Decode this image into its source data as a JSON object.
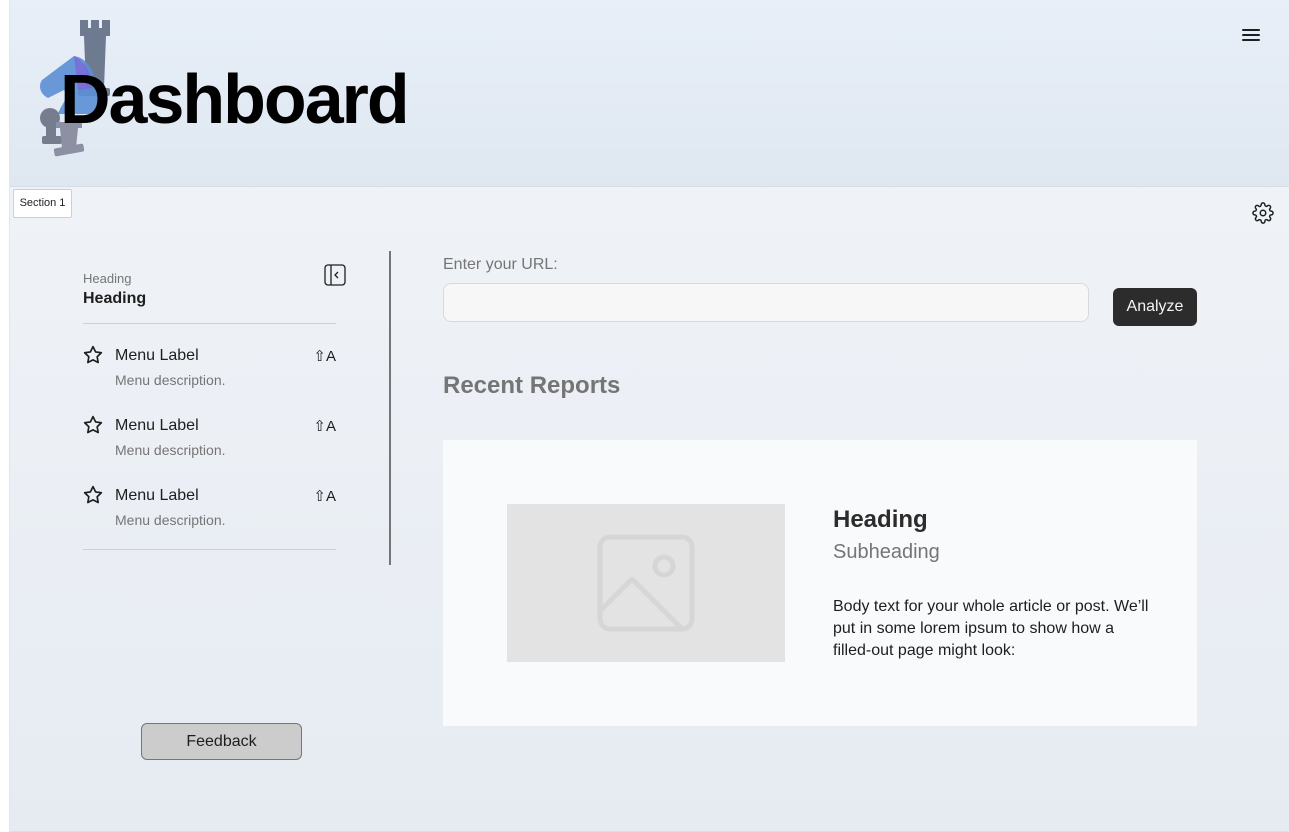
{
  "header": {
    "title": "Dashboard"
  },
  "section": {
    "label": "Section 1"
  },
  "sidebar": {
    "overline": "Heading",
    "title": "Heading",
    "items": [
      {
        "label": "Menu Label",
        "description": "Menu description.",
        "shortcut": "⇧A",
        "icon": "star-icon"
      },
      {
        "label": "Menu Label",
        "description": "Menu description.",
        "shortcut": "⇧A",
        "icon": "star-icon"
      },
      {
        "label": "Menu Label",
        "description": "Menu description.",
        "shortcut": "⇧A",
        "icon": "star-icon"
      }
    ],
    "feedback_label": "Feedback"
  },
  "main": {
    "url_label": "Enter your URL:",
    "url_value": "",
    "analyze_label": "Analyze",
    "reports_title": "Recent Reports",
    "card": {
      "heading": "Heading",
      "subheading": "Subheading",
      "body": "Body text for your whole article or post. We’ll put in some lorem ipsum to show how a filled-out page might look:",
      "image_icon": "image-placeholder-icon"
    }
  },
  "icons": {
    "menu": "hamburger-menu-icon",
    "settings": "gear-icon",
    "sidebar_toggle": "sidebar-collapse-icon",
    "logo": "chess-pieces-logo"
  },
  "colors": {
    "primary_button": "#2c2c2c",
    "secondary_button": "#cccccc",
    "muted_text": "#757575"
  }
}
